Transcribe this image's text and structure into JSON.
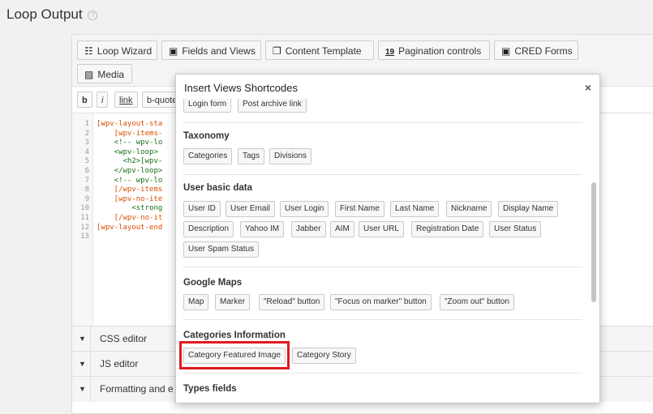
{
  "page": {
    "title": "Loop Output",
    "help_icon": "question-circle-icon"
  },
  "toolbar": {
    "buttons": [
      {
        "label": "Loop Wizard",
        "icon": "grid-icon",
        "glyph": "☷"
      },
      {
        "label": "Fields and Views",
        "icon": "bag-icon",
        "glyph": "▣"
      },
      {
        "label": "Content Template",
        "icon": "copy-icon",
        "glyph": "❐"
      },
      {
        "label": "Pagination controls",
        "icon": "pagination-icon",
        "glyph": "1̲9̲"
      },
      {
        "label": "CRED Forms",
        "icon": "bag-icon",
        "glyph": "▣"
      },
      {
        "label": "Media",
        "icon": "image-icon",
        "glyph": "▨"
      }
    ]
  },
  "format": {
    "bold": "b",
    "italic": "i",
    "link": "link",
    "bquote": "b-quote"
  },
  "editor": {
    "line_numbers": [
      "1",
      "2",
      "3",
      "4",
      "5",
      "6",
      "7",
      "8",
      "9",
      "10",
      "11",
      "12",
      "13"
    ],
    "lines": [
      {
        "text": "[wpv-layout-sta",
        "type": "sc"
      },
      {
        "text": "    [wpv-items-",
        "type": "sc"
      },
      {
        "text": "    <!-- wpv-lo",
        "type": "tg"
      },
      {
        "text": "    <wpv-loop>",
        "type": "tg"
      },
      {
        "text": "      <h2>[wpv-",
        "type": "tg"
      },
      {
        "text": "    </wpv-loop>",
        "type": "tg"
      },
      {
        "text": "    <!-- wpv-lo",
        "type": "tg"
      },
      {
        "text": "    [/wpv-items",
        "type": "sc"
      },
      {
        "text": "    [wpv-no-ite",
        "type": "sc"
      },
      {
        "text": "        <strong",
        "type": "tg"
      },
      {
        "text": "    [/wpv-no-it",
        "type": "sc"
      },
      {
        "text": "[wpv-layout-end",
        "type": "sc"
      },
      {
        "text": "",
        "type": "sc"
      }
    ]
  },
  "sections": {
    "css": "CSS editor",
    "js": "JS editor",
    "formatting": "Formatting and e"
  },
  "dialog": {
    "title": "Insert Views Shortcodes",
    "close": "×",
    "top_partial": [
      "Login form",
      "Post archive link"
    ],
    "taxonomy": {
      "title": "Taxonomy",
      "items": [
        "Categories",
        "Tags",
        "Divisions"
      ]
    },
    "user": {
      "title": "User basic data",
      "row1": [
        "User ID",
        "User Email",
        "User Login",
        "First Name",
        "Last Name",
        "Nickname",
        "Display Name"
      ],
      "row2": [
        "Description",
        "Yahoo IM",
        "Jabber",
        "AIM",
        "User URL",
        "Registration Date",
        "User Status"
      ],
      "row3": [
        "User Spam Status"
      ]
    },
    "maps": {
      "title": "Google Maps",
      "items": [
        "Map",
        "Marker",
        "\"Reload\" button",
        "\"Focus on marker\" button",
        "\"Zoom out\" button"
      ]
    },
    "categories": {
      "title": "Categories Information",
      "items": [
        "Category Featured Image",
        "Category Story"
      ]
    },
    "types": {
      "title": "Types fields"
    }
  },
  "colors": {
    "highlight": "#e0191f",
    "shortcode": "#d94f00",
    "tag": "#167016"
  }
}
